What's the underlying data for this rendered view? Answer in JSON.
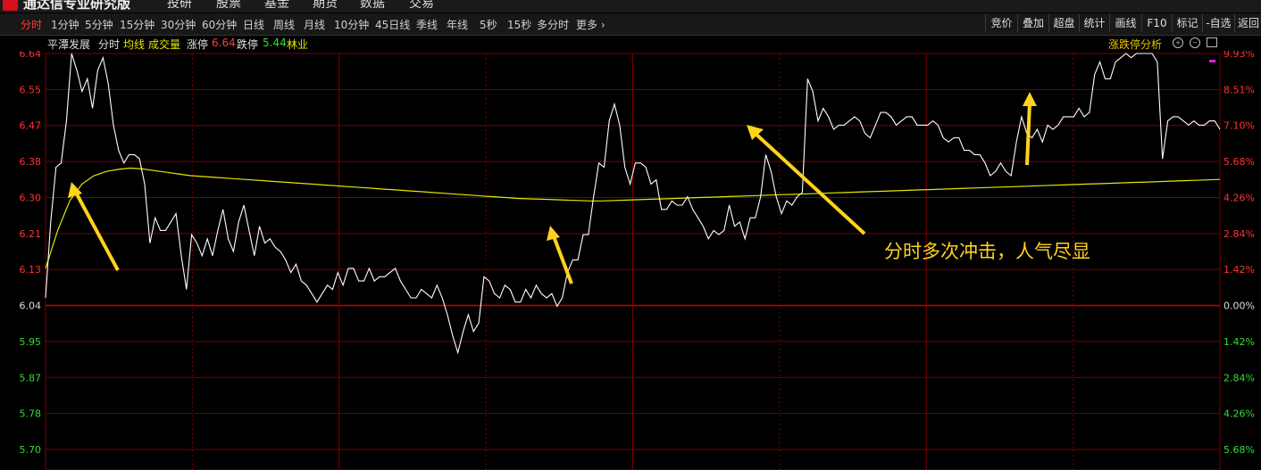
{
  "app": {
    "title": "通达信专业研究版"
  },
  "menu": [
    "投研",
    "股票",
    "基金",
    "期货",
    "数据",
    "交易"
  ],
  "timeframes": [
    {
      "label": "分时",
      "active": true
    },
    {
      "label": "1分钟"
    },
    {
      "label": "5分钟"
    },
    {
      "label": "15分钟"
    },
    {
      "label": "30分钟"
    },
    {
      "label": "60分钟"
    },
    {
      "label": "日线"
    },
    {
      "label": "周线"
    },
    {
      "label": "月线"
    },
    {
      "label": "10分钟"
    },
    {
      "label": "45日线"
    },
    {
      "label": "季线"
    },
    {
      "label": "年线"
    },
    {
      "label": "5秒"
    },
    {
      "label": "15秒"
    },
    {
      "label": "多分时"
    },
    {
      "label": "更多"
    }
  ],
  "tools": [
    "竞价",
    "叠加",
    "超盘",
    "统计",
    "画线",
    "F10",
    "标记",
    "-自选",
    "返回"
  ],
  "info": {
    "stock_name": "平潭发展",
    "mode": "分时",
    "avg_line": "均线",
    "volume": "成交量",
    "limit_up_label": "涨停",
    "limit_up_value": "6.64",
    "limit_down_label": "跌停",
    "limit_down_value": "5.44",
    "sector": "林业",
    "analysis_link": "涨跌停分析"
  },
  "colors": {
    "up": "#ff3333",
    "down": "#33dd33",
    "price_line": "#ffffff",
    "avg_line": "#e6e600",
    "annotation": "#ffd21e",
    "grid": "#7a0000"
  },
  "chart_data": {
    "type": "line",
    "ylim": [
      5.7,
      6.64
    ],
    "prev_close": 6.04,
    "price_ticks": [
      "6.64",
      "6.55",
      "6.47",
      "6.38",
      "6.30",
      "6.21",
      "6.13",
      "6.04",
      "5.95",
      "5.87",
      "5.78",
      "5.70"
    ],
    "pct_ticks": [
      "9.93%",
      "8.51%",
      "7.10%",
      "5.68%",
      "4.26%",
      "2.84%",
      "1.42%",
      "0.00%",
      "1.42%",
      "2.84%",
      "4.26%",
      "5.68%"
    ],
    "series": [
      {
        "values": [
          6.06,
          6.24,
          6.37,
          6.38,
          6.48,
          6.64,
          6.6,
          6.55,
          6.58,
          6.51,
          6.6,
          6.63,
          6.57,
          6.47,
          6.41,
          6.38,
          6.4,
          6.4,
          6.39,
          6.33,
          6.19,
          6.25,
          6.22,
          6.22,
          6.24,
          6.26,
          6.16,
          6.08,
          6.21,
          6.19,
          6.16,
          6.2,
          6.16,
          6.22,
          6.27,
          6.2,
          6.17,
          6.24,
          6.28,
          6.22,
          6.16,
          6.23,
          6.19,
          6.2,
          6.18,
          6.17,
          6.15,
          6.12,
          6.14,
          6.1,
          6.09,
          6.07,
          6.05,
          6.07,
          6.09,
          6.08,
          6.12,
          6.09,
          6.13,
          6.13,
          6.1,
          6.1,
          6.13,
          6.1,
          6.11,
          6.11,
          6.12,
          6.13,
          6.1,
          6.08,
          6.06,
          6.06,
          6.08,
          6.07,
          6.06,
          6.09,
          6.06,
          6.02,
          5.97,
          5.93,
          5.98,
          6.02,
          5.98,
          6.0,
          6.11,
          6.1,
          6.07,
          6.06,
          6.09,
          6.08,
          6.05,
          6.05,
          6.08,
          6.06,
          6.09,
          6.07,
          6.06,
          6.07,
          6.04,
          6.06,
          6.12,
          6.15,
          6.15,
          6.21,
          6.21,
          6.3,
          6.38,
          6.37,
          6.48,
          6.52,
          6.47,
          6.37,
          6.33,
          6.38,
          6.38,
          6.37,
          6.33,
          6.34,
          6.27,
          6.27,
          6.29,
          6.28,
          6.28,
          6.3,
          6.27,
          6.25,
          6.23,
          6.2,
          6.22,
          6.21,
          6.22,
          6.28,
          6.23,
          6.24,
          6.2,
          6.25,
          6.25,
          6.3,
          6.4,
          6.36,
          6.3,
          6.26,
          6.29,
          6.28,
          6.3,
          6.31,
          6.58,
          6.55,
          6.48,
          6.51,
          6.49,
          6.46,
          6.47,
          6.47,
          6.48,
          6.49,
          6.48,
          6.45,
          6.44,
          6.47,
          6.5,
          6.5,
          6.49,
          6.47,
          6.48,
          6.49,
          6.49,
          6.47,
          6.47,
          6.47,
          6.48,
          6.47,
          6.44,
          6.43,
          6.44,
          6.44,
          6.41,
          6.41,
          6.4,
          6.4,
          6.38,
          6.35,
          6.36,
          6.38,
          6.36,
          6.35,
          6.43,
          6.49,
          6.45,
          6.44,
          6.46,
          6.43,
          6.47,
          6.46,
          6.47,
          6.49,
          6.49,
          6.49,
          6.51,
          6.49,
          6.5,
          6.59,
          6.62,
          6.58,
          6.58,
          6.62,
          6.63,
          6.64,
          6.63,
          6.64,
          6.64,
          6.64,
          6.64,
          6.62,
          6.39,
          6.48,
          6.49,
          6.49,
          6.48,
          6.47,
          6.48,
          6.47,
          6.47,
          6.48,
          6.48,
          6.46
        ]
      },
      {
        "values": [
          6.13,
          6.22,
          6.29,
          6.33,
          6.35,
          6.36,
          6.365,
          6.368,
          6.366,
          6.362,
          6.358,
          6.354,
          6.35,
          6.348,
          6.346,
          6.344,
          6.342,
          6.34,
          6.338,
          6.336,
          6.334,
          6.332,
          6.33,
          6.328,
          6.326,
          6.324,
          6.322,
          6.32,
          6.318,
          6.316,
          6.314,
          6.312,
          6.31,
          6.308,
          6.306,
          6.304,
          6.302,
          6.3,
          6.298,
          6.296,
          6.295,
          6.294,
          6.293,
          6.292,
          6.291,
          6.29,
          6.29,
          6.291,
          6.292,
          6.293,
          6.294,
          6.295,
          6.296,
          6.297,
          6.298,
          6.299,
          6.3,
          6.301,
          6.302,
          6.303,
          6.304,
          6.305,
          6.306,
          6.307,
          6.308,
          6.309,
          6.31,
          6.311,
          6.312,
          6.313,
          6.314,
          6.315,
          6.316,
          6.317,
          6.318,
          6.319,
          6.32,
          6.321,
          6.322,
          6.323,
          6.324,
          6.325,
          6.326,
          6.327,
          6.328,
          6.329,
          6.33,
          6.331,
          6.332,
          6.333,
          6.334,
          6.335,
          6.336,
          6.337,
          6.338,
          6.339,
          6.34,
          6.341
        ]
      }
    ],
    "annotations": [
      {
        "text": "分时多次冲击，人气尽显"
      }
    ]
  }
}
